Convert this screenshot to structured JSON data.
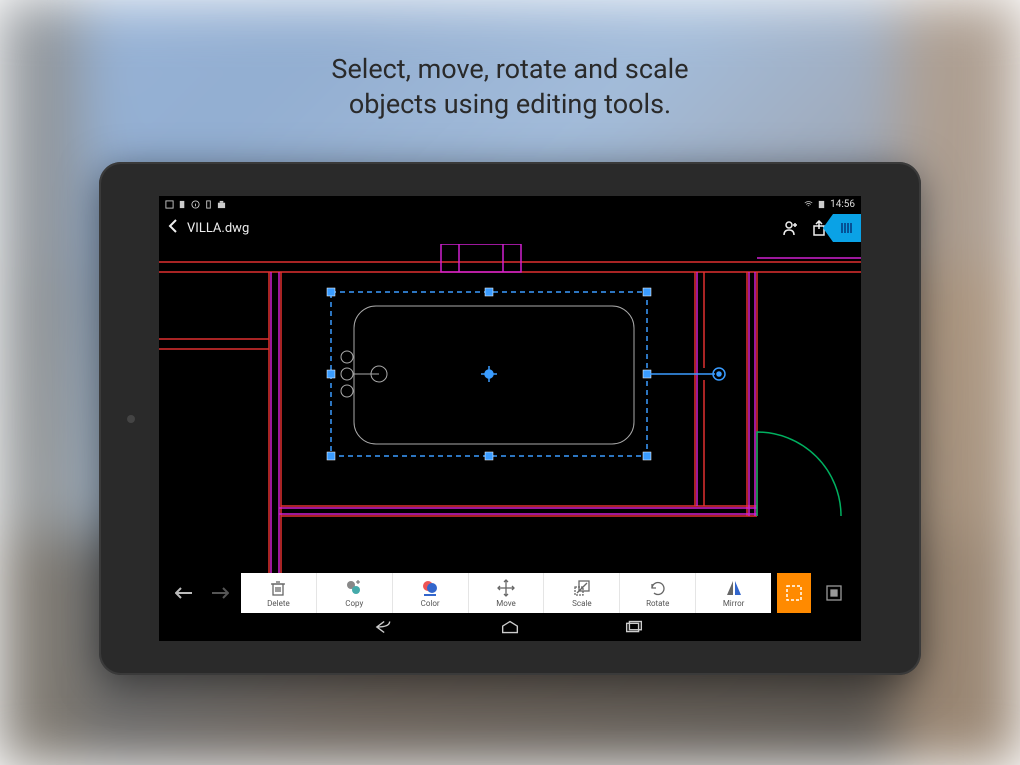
{
  "promo": {
    "line1": "Select, move, rotate and scale",
    "line2": "objects using editing tools."
  },
  "statusbar": {
    "time": "14:56"
  },
  "appbar": {
    "filename": "VILLA.dwg"
  },
  "tools": {
    "delete": "Delete",
    "copy": "Copy",
    "color": "Color",
    "move": "Move",
    "scale": "Scale",
    "rotate": "Rotate",
    "mirror": "Mirror"
  },
  "colors": {
    "accent": "#ff8a00",
    "select": "#3a9cff",
    "cyan": "#0aa2e6",
    "wall_red": "#e03030",
    "wall_magenta": "#d020d0",
    "wall_green": "#00b060"
  }
}
